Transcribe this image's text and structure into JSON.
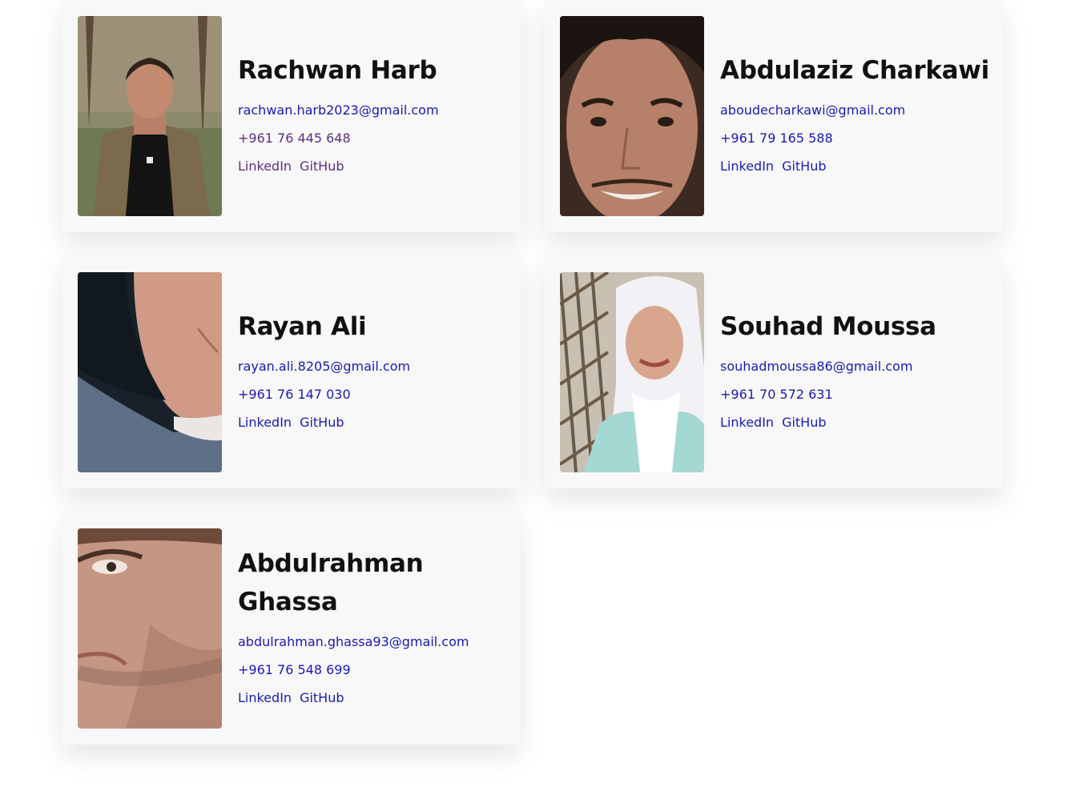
{
  "team": [
    {
      "name_lines": [
        "Rachwan Harb"
      ],
      "email": "rachwan.harb2023@gmail.com",
      "phone": "+961 76 445 648",
      "links": [
        "LinkedIn",
        "GitHub"
      ],
      "photo_icon": "person-photo"
    },
    {
      "name_lines": [
        "Abdulaziz Charkawi"
      ],
      "email": "aboudecharkawi@gmail.com",
      "phone": "+961 79 165 588",
      "links": [
        "LinkedIn",
        "GitHub"
      ],
      "photo_icon": "person-photo"
    },
    {
      "name_lines": [
        "Rayan Ali"
      ],
      "email": "rayan.ali.8205@gmail.com",
      "phone": "+961 76 147 030",
      "links": [
        "LinkedIn",
        "GitHub"
      ],
      "photo_icon": "person-photo"
    },
    {
      "name_lines": [
        "Souhad Moussa"
      ],
      "email": "souhadmoussa86@gmail.com",
      "phone": "+961 70 572 631",
      "links": [
        "LinkedIn",
        "GitHub"
      ],
      "photo_icon": "person-photo"
    },
    {
      "name_lines": [
        "Abdulrahman",
        "Ghassa"
      ],
      "email": "abdulrahman.ghassa93@gmail.com",
      "phone": "+961 76 548 699",
      "links": [
        "LinkedIn",
        "GitHub"
      ],
      "photo_icon": "person-photo"
    }
  ],
  "colors": {
    "link": "#1a1ab8",
    "visited_link": "#5c2f84",
    "name": "#111111",
    "card_bg": "#f8f8f8"
  }
}
